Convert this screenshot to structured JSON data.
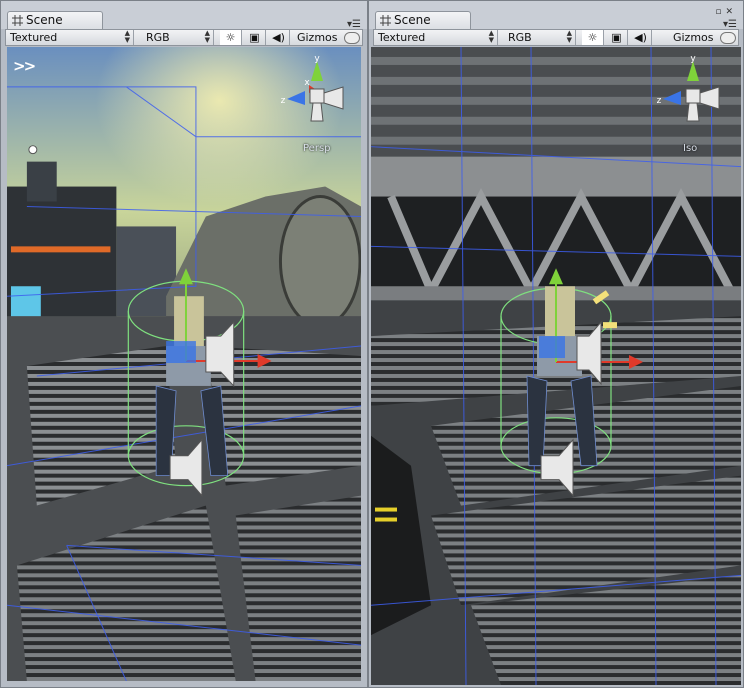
{
  "panels": [
    {
      "tab_label": "Scene",
      "toolbar": {
        "render_mode": "Textured",
        "color_mode": "RGB",
        "gizmos_label": "Gizmos",
        "icons": [
          "lighting-icon",
          "image-icon",
          "audio-icon"
        ]
      },
      "projection_label": "Persp"
    },
    {
      "tab_label": "Scene",
      "toolbar": {
        "render_mode": "Textured",
        "color_mode": "RGB",
        "gizmos_label": "Gizmos",
        "icons": [
          "lighting-icon",
          "image-icon",
          "audio-icon"
        ]
      },
      "projection_label": "Iso"
    }
  ],
  "gizmo_axes": [
    "y",
    "x",
    "z"
  ],
  "colors": {
    "axis_x": "#e03a2a",
    "axis_y": "#7fd23a",
    "axis_z": "#3a74e6",
    "wire_blue": "#3d5ef0",
    "capsule_green": "#7fe07f",
    "bg_panel": "#b6bcc5"
  }
}
